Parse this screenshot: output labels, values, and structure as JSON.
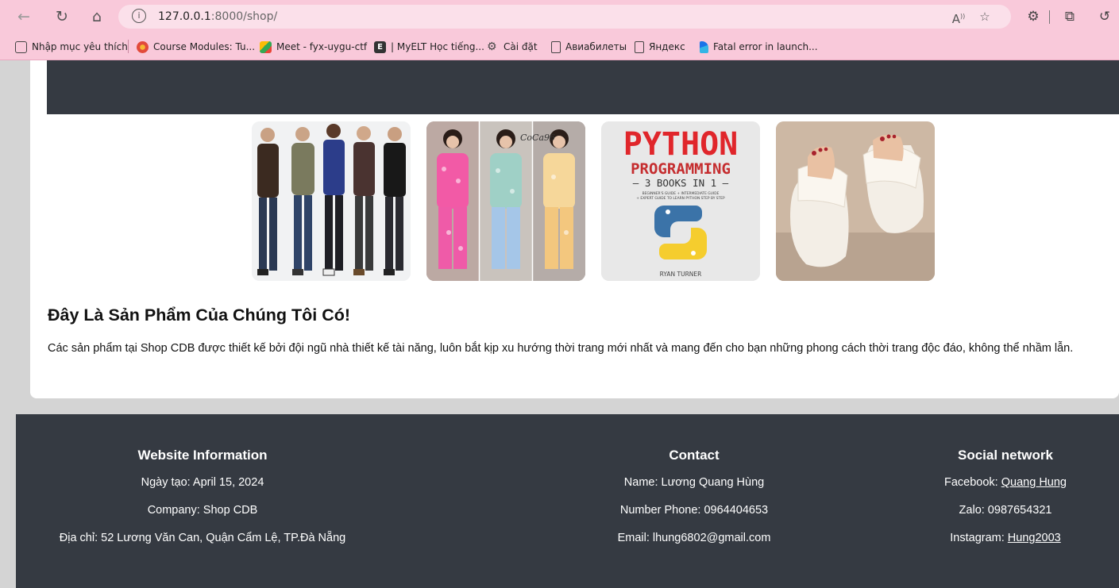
{
  "browser": {
    "url_host": "127.0.0.1",
    "url_path": ":8000/shop/",
    "bookmarks": [
      "Nhập mục yêu thích",
      "Course Modules: Tu...",
      "Meet - fyx-uygu-ctf",
      "| MyELT Học tiếng...",
      "Cài đặt",
      "Авиабилеты",
      "Яндекс",
      "Fatal error in launch..."
    ]
  },
  "content": {
    "products": [
      {
        "alt": "men-fashion-image"
      },
      {
        "alt": "women-pajamas-image"
      },
      {
        "alt": "python-book-image"
      },
      {
        "alt": "sandals-image"
      }
    ],
    "book": {
      "title1": "PYTHON",
      "title2": "PROGRAMMING",
      "subtitle": "— 3 BOOKS IN 1 —",
      "tagline1": "BEGINNER'S GUIDE + INTERMEDIATE GUIDE",
      "tagline2": "+ EXPERT GUIDE TO LEARN PYTHON STEP BY STEP",
      "author": "RYAN TURNER"
    },
    "pajama_brand": "CoCa96",
    "heading": "Đây Là Sản Phẩm Của Chúng Tôi Có!",
    "description": "Các sản phẩm tại Shop CDB được thiết kế bởi đội ngũ nhà thiết kế tài năng, luôn bắt kịp xu hướng thời trang mới nhất và mang đến cho bạn những phong cách thời trang độc đáo, không thể nhầm lẫn."
  },
  "footer": {
    "info": {
      "title": "Website Information",
      "created": "Ngày tạo: April 15, 2024",
      "company": "Company: Shop CDB",
      "address": "Địa chỉ: 52 Lương Văn Can, Quận Cẩm Lệ, TP.Đà Nẵng"
    },
    "contact": {
      "title": "Contact",
      "name": "Name: Lương Quang Hùng",
      "phone": "Number Phone: 0964404653",
      "email": "Email: lhung6802@gmail.com"
    },
    "social": {
      "title": "Social network",
      "facebook_label": "Facebook: ",
      "facebook_link": "Quang Hung",
      "zalo": "Zalo: 0987654321",
      "instagram_label": "Instagram: ",
      "instagram_link": "Hung2003"
    }
  },
  "colors": {
    "chrome": "#f9c9da",
    "banner": "#353a42",
    "footer": "#353a42"
  }
}
